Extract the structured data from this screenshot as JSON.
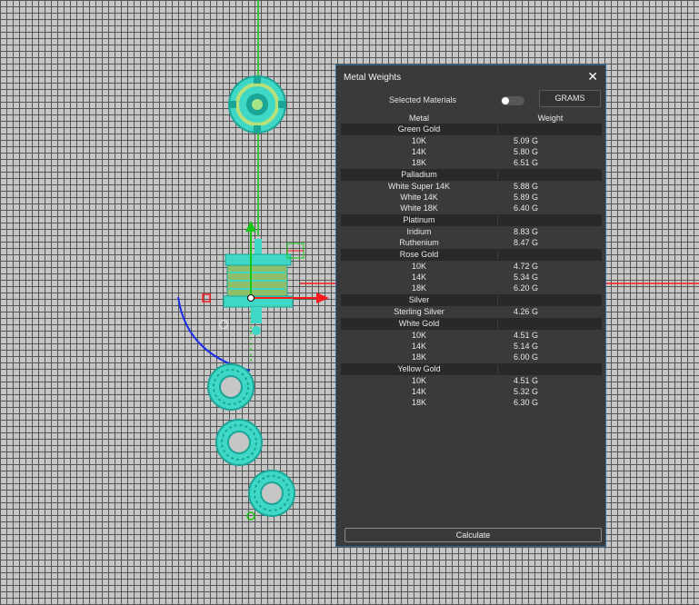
{
  "panel": {
    "title": "Metal Weights",
    "selected_materials_label": "Selected Materials",
    "selected_materials_enabled": false,
    "units_button": "GRAMS",
    "col_metal": "Metal",
    "col_weight": "Weight",
    "calculate_label": "Calculate",
    "close_icon": "close-icon"
  },
  "groups": [
    {
      "name": "Green Gold",
      "rows": [
        {
          "metal": "10K",
          "weight": "5.09 G"
        },
        {
          "metal": "14K",
          "weight": "5.80 G"
        },
        {
          "metal": "18K",
          "weight": "6.51 G"
        }
      ]
    },
    {
      "name": "Palladium",
      "rows": [
        {
          "metal": "White Super 14K",
          "weight": "5.88 G"
        },
        {
          "metal": "White 14K",
          "weight": "5.89 G"
        },
        {
          "metal": "White 18K",
          "weight": "6.40 G"
        }
      ]
    },
    {
      "name": "Platinum",
      "rows": [
        {
          "metal": "Iridium",
          "weight": "8.83 G"
        },
        {
          "metal": "Ruthenium",
          "weight": "8.47 G"
        }
      ]
    },
    {
      "name": "Rose Gold",
      "rows": [
        {
          "metal": "10K",
          "weight": "4.72 G"
        },
        {
          "metal": "14K",
          "weight": "5.34 G"
        },
        {
          "metal": "18K",
          "weight": "6.20 G"
        }
      ]
    },
    {
      "name": "Silver",
      "rows": [
        {
          "metal": "Sterling Silver",
          "weight": "4.26 G"
        }
      ]
    },
    {
      "name": "White Gold",
      "rows": [
        {
          "metal": "10K",
          "weight": "4.51 G"
        },
        {
          "metal": "14K",
          "weight": "5.14 G"
        },
        {
          "metal": "18K",
          "weight": "6.00 G"
        }
      ]
    },
    {
      "name": "Yellow Gold",
      "rows": [
        {
          "metal": "10K",
          "weight": "4.51 G"
        },
        {
          "metal": "14K",
          "weight": "5.32 G"
        },
        {
          "metal": "18K",
          "weight": "6.30 G"
        }
      ]
    }
  ],
  "colors": {
    "model": "#3fd8c6",
    "model_dark": "#1aa597",
    "axis_x": "#ff1a1a",
    "axis_y": "#14c814",
    "arc": "#1a2de8",
    "panel_border": "#2f6b96"
  }
}
